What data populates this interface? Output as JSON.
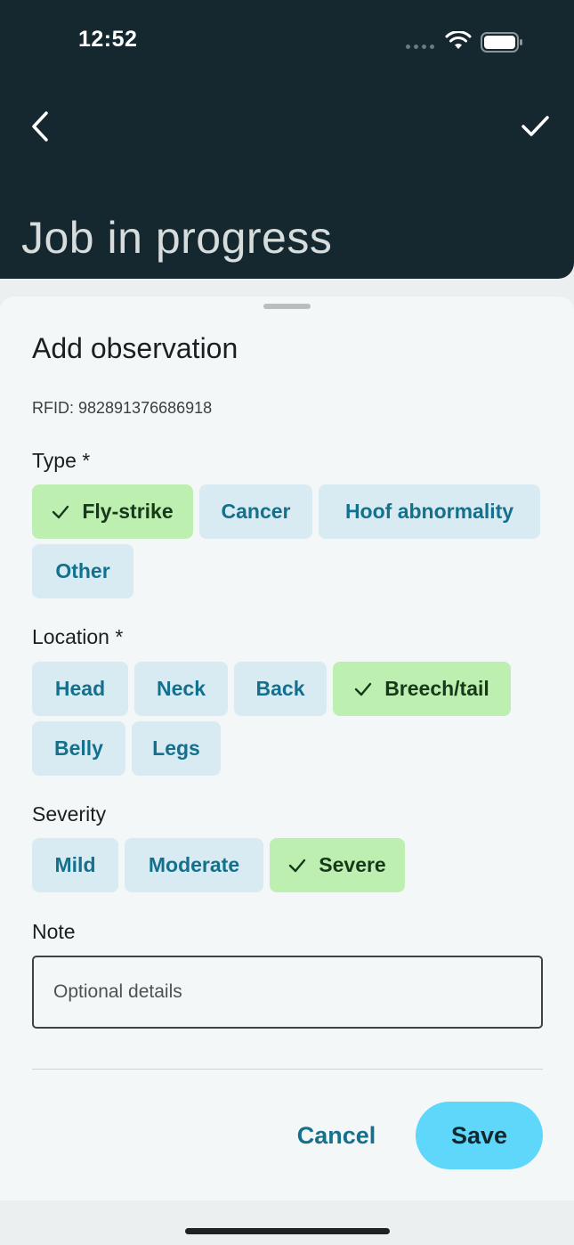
{
  "status_bar": {
    "time": "12:52"
  },
  "header": {
    "title": "Job in progress"
  },
  "sheet": {
    "title": "Add observation",
    "rfid": "RFID: 982891376686918",
    "type": {
      "label": "Type *",
      "options": [
        {
          "label": "Fly-strike",
          "selected": true
        },
        {
          "label": "Cancer",
          "selected": false
        },
        {
          "label": "Hoof abnormality",
          "selected": false
        },
        {
          "label": "Other",
          "selected": false
        }
      ]
    },
    "location": {
      "label": "Location *",
      "options": [
        {
          "label": "Head",
          "selected": false
        },
        {
          "label": "Neck",
          "selected": false
        },
        {
          "label": "Back",
          "selected": false
        },
        {
          "label": "Breech/tail",
          "selected": true
        },
        {
          "label": "Belly",
          "selected": false
        },
        {
          "label": "Legs",
          "selected": false
        }
      ]
    },
    "severity": {
      "label": "Severity",
      "options": [
        {
          "label": "Mild",
          "selected": false
        },
        {
          "label": "Moderate",
          "selected": false
        },
        {
          "label": "Severe",
          "selected": true
        }
      ]
    },
    "note": {
      "label": "Note",
      "placeholder": "Optional details",
      "value": ""
    },
    "actions": {
      "cancel": "Cancel",
      "save": "Save"
    }
  },
  "colors": {
    "header_bg": "#15272f",
    "chip_bg": "#d8ebf2",
    "chip_text": "#14708d",
    "chip_selected_bg": "#bdf0b0",
    "save_bg": "#5fd7fb"
  }
}
